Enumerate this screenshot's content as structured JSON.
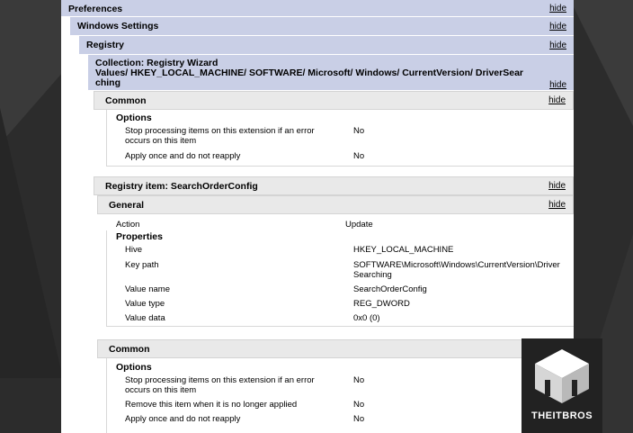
{
  "preferences": {
    "title": "Preferences",
    "hide": "hide"
  },
  "windows_settings": {
    "title": "Windows Settings",
    "hide": "hide"
  },
  "registry": {
    "title": "Registry",
    "hide": "hide"
  },
  "collection": {
    "line1": "Collection: Registry Wizard",
    "line2": "Values/ HKEY_LOCAL_MACHINE/ SOFTWARE/ Microsoft/ Windows/ CurrentVersion/ DriverSear",
    "line3": "ching",
    "hide": "hide"
  },
  "common1": {
    "title": "Common",
    "hide": "hide",
    "options_title": "Options",
    "rows": [
      {
        "label_a": "Stop processing items on this extension if an error",
        "label_b": "occurs on this item",
        "value": "No"
      },
      {
        "label_a": "Apply once and do not reapply",
        "label_b": "",
        "value": "No"
      }
    ]
  },
  "registry_item": {
    "title": "Registry item: SearchOrderConfig",
    "hide": "hide"
  },
  "general": {
    "title": "General",
    "hide": "hide",
    "action_label": "Action",
    "action_value": "Update",
    "properties_title": "Properties",
    "props": [
      {
        "label": "Hive",
        "value_a": "HKEY_LOCAL_MACHINE",
        "value_b": ""
      },
      {
        "label": "Key path",
        "value_a": "SOFTWARE\\Microsoft\\Windows\\CurrentVersion\\Driver",
        "value_b": "Searching"
      },
      {
        "label": "Value name",
        "value_a": "SearchOrderConfig",
        "value_b": ""
      },
      {
        "label": "Value type",
        "value_a": "REG_DWORD",
        "value_b": ""
      },
      {
        "label": "Value data",
        "value_a": "0x0 (0)",
        "value_b": ""
      }
    ]
  },
  "common2": {
    "title": "Common",
    "options_title": "Options",
    "rows": [
      {
        "label_a": "Stop processing items on this extension if an error",
        "label_b": "occurs on this item",
        "value": "No"
      },
      {
        "label_a": "Remove this item when it is no longer applied",
        "label_b": "",
        "value": "No"
      },
      {
        "label_a": "Apply once and do not reapply",
        "label_b": "",
        "value": "No"
      }
    ]
  },
  "watermark": {
    "text": "THEITBROS"
  }
}
